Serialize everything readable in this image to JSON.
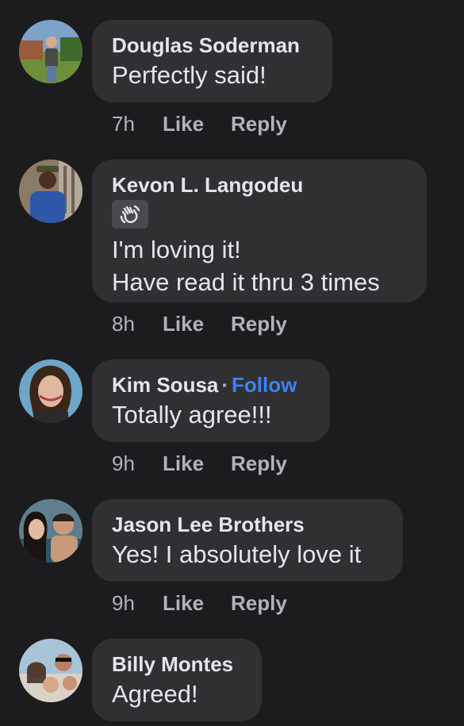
{
  "comments": [
    {
      "name": "Douglas Soderman",
      "text_lines": [
        "Perfectly said!"
      ],
      "time": "7h",
      "like": "Like",
      "reply": "Reply"
    },
    {
      "name": "Kevon L. Langodeu",
      "badge_icon": "waving-hand-icon",
      "text_lines": [
        "I'm loving it!",
        "Have read it thru 3 times"
      ],
      "time": "8h",
      "like": "Like",
      "reply": "Reply"
    },
    {
      "name": "Kim Sousa",
      "separator": "·",
      "follow": "Follow",
      "text_lines": [
        "Totally agree!!!"
      ],
      "time": "9h",
      "like": "Like",
      "reply": "Reply"
    },
    {
      "name": "Jason Lee Brothers",
      "text_lines": [
        "Yes! I absolutely love it"
      ],
      "time": "9h",
      "like": "Like",
      "reply": "Reply"
    },
    {
      "name": "Billy Montes",
      "text_lines": [
        "Agreed!"
      ]
    }
  ],
  "colors": {
    "background": "#1c1c1e",
    "bubble": "#303033",
    "follow": "#3b82f6",
    "meta": "#b0b3b8"
  }
}
